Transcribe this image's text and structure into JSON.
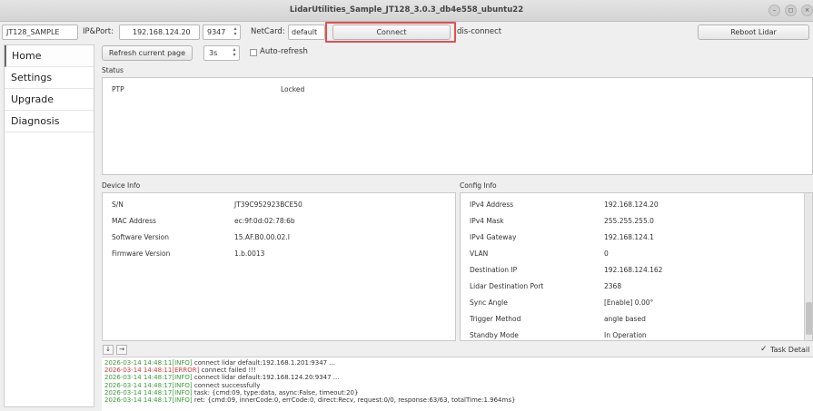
{
  "window": {
    "title": "LidarUtilities_Sample_JT128_3.0.3_db4e558_ubuntu22",
    "minimize": "–",
    "maximize": "◻",
    "close": "×"
  },
  "toolbar": {
    "device_type": "JT128_SAMPLE",
    "ip_port_label": "IP&Port:",
    "ip_value": "192.168.124.20",
    "port_value": "9347",
    "netcard_label": "NetCard:",
    "netcard_value": "default",
    "connect_label": "Connect",
    "status_text": "dis-connect",
    "reboot_label": "Reboot Lidar",
    "refresh_label": "Refresh current page",
    "interval_value": "3s",
    "auto_refresh_label": "Auto-refresh"
  },
  "sidebar": {
    "items": [
      {
        "label": "Home"
      },
      {
        "label": "Settings"
      },
      {
        "label": "Upgrade"
      },
      {
        "label": "Diagnosis"
      }
    ]
  },
  "status": {
    "title": "Status",
    "rows": [
      {
        "key": "PTP",
        "value": "Locked"
      }
    ]
  },
  "device_info": {
    "title": "Device Info",
    "rows": [
      {
        "key": "S/N",
        "value": "JT39C952923BCE50"
      },
      {
        "key": "MAC Address",
        "value": "ec:9f:0d:02:78:6b"
      },
      {
        "key": "Software Version",
        "value": "15.AF.B0.00.02.I"
      },
      {
        "key": "Firmware Version",
        "value": "1.b.0013"
      }
    ]
  },
  "config_info": {
    "title": "Config Info",
    "rows": [
      {
        "key": "IPv4 Address",
        "value": "192.168.124.20"
      },
      {
        "key": "IPv4 Mask",
        "value": "255.255.255.0"
      },
      {
        "key": "IPv4 Gateway",
        "value": "192.168.124.1"
      },
      {
        "key": "VLAN",
        "value": "0"
      },
      {
        "key": "Destination IP",
        "value": "192.168.124.162"
      },
      {
        "key": "Lidar Destination Port",
        "value": "2368"
      },
      {
        "key": "Sync Angle",
        "value": "[Enable] 0.00°"
      },
      {
        "key": "Trigger Method",
        "value": "angle based"
      },
      {
        "key": "Standby Mode",
        "value": "In Operation"
      }
    ]
  },
  "log_controls": {
    "down_label": "↓",
    "right_label": "→",
    "task_detail_label": "Task Detail",
    "task_detail_checked": true
  },
  "log": [
    {
      "ts": "2026-03-14 14:48:11",
      "level": "[INFO]",
      "text": " connect lidar default:192.168.1.201:9347 ..."
    },
    {
      "ts": "2026-03-14 14:48:11",
      "level": "[ERROR]",
      "text": " connect failed !!!"
    },
    {
      "ts": "2026-03-14 14:48:17",
      "level": "[INFO]",
      "text": " connect lidar default:192.168.124.20:9347 ..."
    },
    {
      "ts": "2026-03-14 14:48:17",
      "level": "[INFO]",
      "text": " connect successfully"
    },
    {
      "ts": "2026-03-14 14:48:17",
      "level": "[INFO]",
      "text": " task: {cmd:09, type:data, async:False, timeout:20}"
    },
    {
      "ts": "2026-03-14 14:48:17",
      "level": "[INFO]",
      "text": " ret: {cmd:09, innerCode:0, errCode:0, direct:Recv, request:0/0, response:63/63, totalTime:1.964ms}"
    }
  ],
  "colors": {
    "highlight": "#e05050",
    "log_info": "#3a9a3a",
    "log_error": "#d83a3a"
  }
}
